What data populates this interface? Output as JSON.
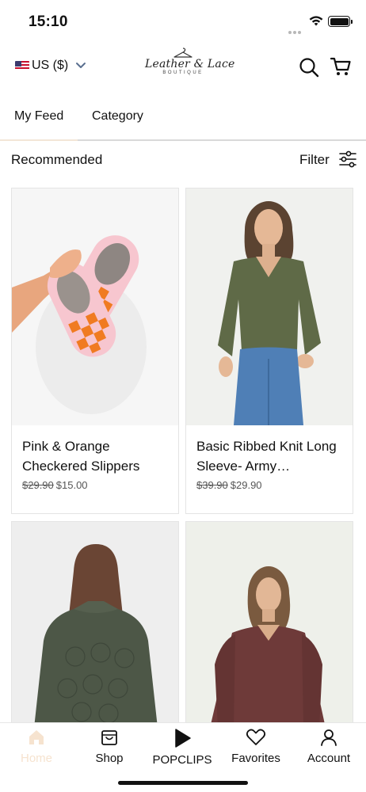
{
  "status_bar": {
    "time": "15:10"
  },
  "header": {
    "currency_label": "US ($)",
    "logo_text": "Leather & Lace",
    "logo_subtext": "BOUTIQUE"
  },
  "tabs": [
    {
      "label": "My Feed",
      "selected": true
    },
    {
      "label": "Category",
      "selected": false
    }
  ],
  "section": {
    "title": "Recommended",
    "filter_label": "Filter"
  },
  "products": [
    {
      "name": "Pink & Orange Checkered Slippers",
      "old_price": "$29.90",
      "price": "$15.00"
    },
    {
      "name": "Basic Ribbed Knit Long Sleeve- Army…",
      "old_price": "$39.90",
      "price": "$29.90"
    },
    {
      "name": "",
      "old_price": "",
      "price": ""
    },
    {
      "name": "",
      "old_price": "",
      "price": ""
    }
  ],
  "bottom_nav": [
    {
      "label": "Home",
      "icon": "home-icon",
      "active": true
    },
    {
      "label": "Shop",
      "icon": "shop-icon",
      "active": false
    },
    {
      "label": "POPCLIPS",
      "icon": "play-icon",
      "active": false
    },
    {
      "label": "Favorites",
      "icon": "heart-icon",
      "active": false
    },
    {
      "label": "Account",
      "icon": "user-icon",
      "active": false
    }
  ],
  "colors": {
    "accent": "#f3e6d7",
    "text": "#111111",
    "muted_price": "#555555"
  }
}
